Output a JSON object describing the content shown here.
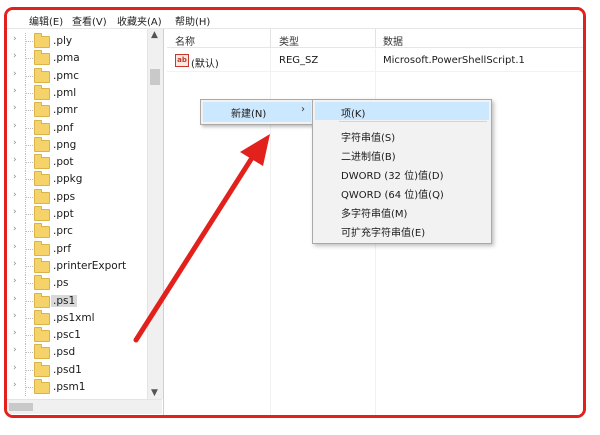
{
  "menubar": {
    "items": [
      "编辑(E)",
      "查看(V)",
      "收藏夹(A)",
      "帮助(H)"
    ]
  },
  "tree": {
    "items": [
      ".ply",
      ".pma",
      ".pmc",
      ".pml",
      ".pmr",
      ".pnf",
      ".png",
      ".pot",
      ".ppkg",
      ".pps",
      ".ppt",
      ".prc",
      ".prf",
      ".printerExport",
      ".ps",
      ".ps1",
      ".ps1xml",
      ".psc1",
      ".psd",
      ".psd1",
      ".psm1"
    ],
    "selected": ".ps1"
  },
  "list": {
    "columns": [
      "名称",
      "类型",
      "数据"
    ],
    "rows": [
      {
        "name": "(默认)",
        "type": "REG_SZ",
        "data": "Microsoft.PowerShellScript.1",
        "icon": "reg-string-icon"
      }
    ]
  },
  "context_menu": {
    "new_label": "新建(N)",
    "submenu_arrow": "›",
    "submenu": [
      "项(K)",
      "字符串值(S)",
      "二进制值(B)",
      "DWORD (32 位)值(D)",
      "QWORD (64 位)值(Q)",
      "多字符串值(M)",
      "可扩充字符串值(E)"
    ]
  },
  "colors": {
    "highlight": "#cce8ff",
    "annotation_red": "#e2211c",
    "folder": "#f5d36a"
  }
}
